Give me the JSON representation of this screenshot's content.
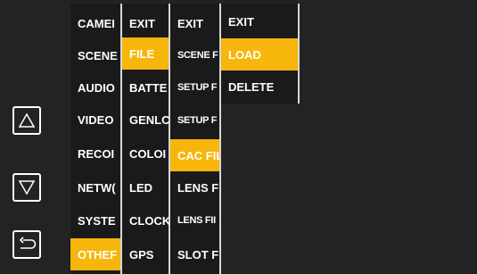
{
  "colors": {
    "background": "#232323",
    "selected": "#f6b60b",
    "text": "#ffffff"
  },
  "nav": {
    "up_icon": "triangle-up-icon",
    "down_icon": "triangle-down-icon",
    "back_icon": "return-arrow-icon"
  },
  "columns": [
    {
      "name": "main-menu",
      "items": [
        {
          "label": "CAMEI",
          "selected": false
        },
        {
          "label": "SCENE",
          "selected": false
        },
        {
          "label": "AUDIO",
          "selected": false
        },
        {
          "label": "VIDEO",
          "selected": false
        },
        {
          "label": "RECOI",
          "selected": false
        },
        {
          "label": "NETW(",
          "selected": false
        },
        {
          "label": "SYSTE",
          "selected": false
        },
        {
          "label": "OTHEF",
          "selected": true
        }
      ]
    },
    {
      "name": "others-menu",
      "items": [
        {
          "label": "EXIT",
          "selected": false
        },
        {
          "label": "FILE",
          "selected": true
        },
        {
          "label": "BATTE",
          "selected": false
        },
        {
          "label": "GENLC",
          "selected": false
        },
        {
          "label": "COLOI",
          "selected": false
        },
        {
          "label": "LED",
          "selected": false
        },
        {
          "label": "CLOCK",
          "selected": false
        },
        {
          "label": "GPS",
          "selected": false
        }
      ]
    },
    {
      "name": "file-menu",
      "items": [
        {
          "label": "EXIT",
          "selected": false,
          "small": false
        },
        {
          "label": "SCENE F",
          "selected": false,
          "small": true
        },
        {
          "label": "SETUP F",
          "selected": false,
          "small": true
        },
        {
          "label": "SETUP F",
          "selected": false,
          "small": true
        },
        {
          "label": "CAC FIL",
          "selected": true,
          "small": false
        },
        {
          "label": "LENS F",
          "selected": false,
          "small": false
        },
        {
          "label": "LENS FII",
          "selected": false,
          "small": true
        },
        {
          "label": "SLOT F",
          "selected": false,
          "small": false
        }
      ]
    },
    {
      "name": "cac-file-menu",
      "items": [
        {
          "label": "EXIT",
          "selected": false
        },
        {
          "label": "LOAD",
          "selected": true
        },
        {
          "label": "DELETE",
          "selected": false
        }
      ]
    }
  ]
}
